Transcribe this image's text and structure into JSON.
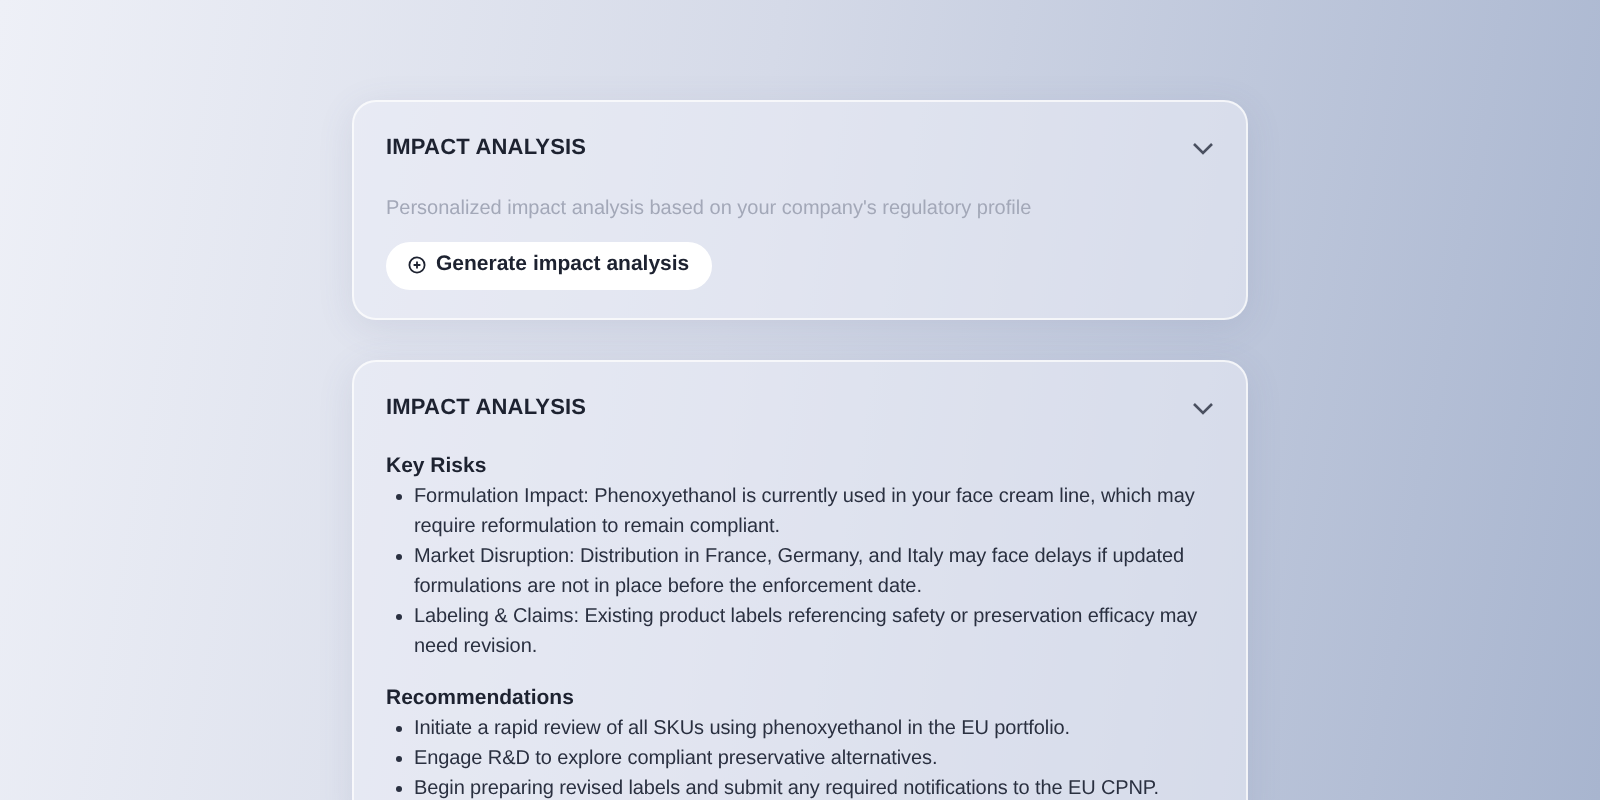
{
  "panels": [
    {
      "title": "IMPACT ANALYSIS",
      "description": "Personalized impact analysis based on your company's regulatory profile",
      "button": "Generate impact analysis"
    },
    {
      "title": "IMPACT ANALYSIS",
      "sections": [
        {
          "heading": "Key Risks",
          "items": [
            "Formulation Impact: Phenoxyethanol is currently used in your face cream line, which may require reformulation to remain compliant.",
            "Market Disruption: Distribution in France, Germany, and Italy may face delays if updated formulations are not in place before the enforcement date.",
            "Labeling & Claims: Existing product labels referencing safety or preservation efficacy may need revision."
          ]
        },
        {
          "heading": "Recommendations",
          "items": [
            "Initiate a rapid review of all SKUs using phenoxyethanol in the EU portfolio.",
            "Engage R&D to explore compliant preservative alternatives.",
            "Begin preparing revised labels and submit any required notifications to the EU CPNP."
          ]
        }
      ]
    }
  ]
}
